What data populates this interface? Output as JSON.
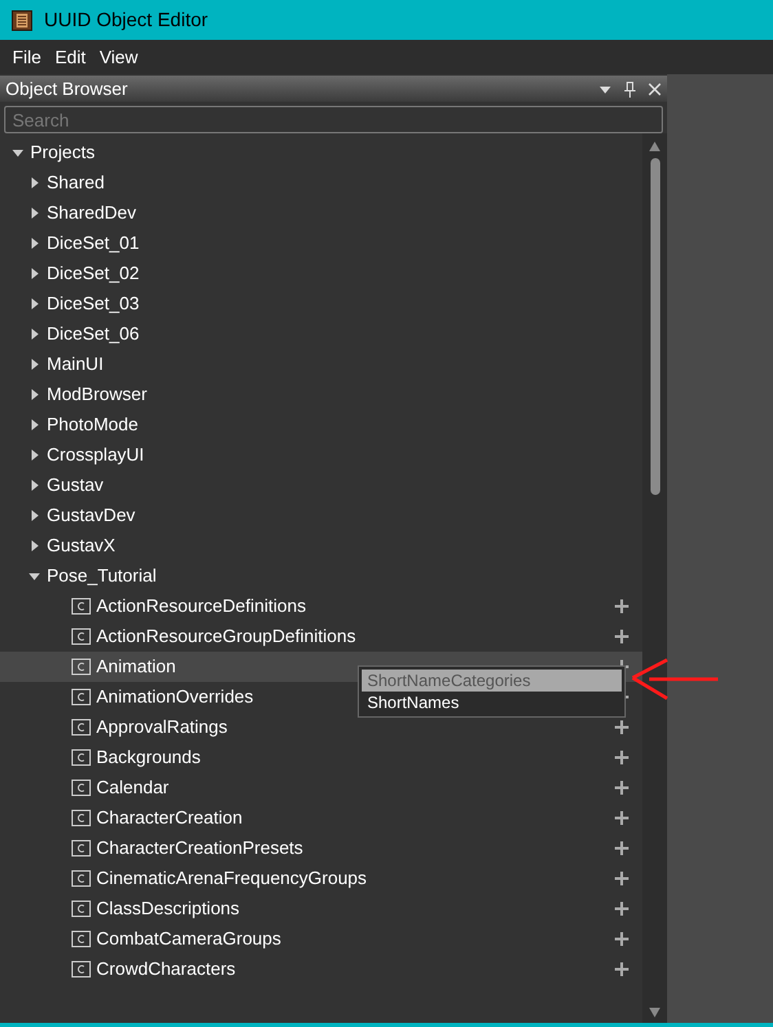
{
  "window": {
    "title": "UUID Object Editor"
  },
  "menu": [
    "File",
    "Edit",
    "View"
  ],
  "panel": {
    "title": "Object Browser",
    "search": {
      "placeholder": "Search"
    }
  },
  "tree": [
    {
      "label": "Projects",
      "expanded": true,
      "selected": false,
      "children": [
        {
          "label": "Shared",
          "expanded": false,
          "selected": false
        },
        {
          "label": "SharedDev",
          "expanded": false,
          "selected": false
        },
        {
          "label": "DiceSet_01",
          "expanded": false,
          "selected": false
        },
        {
          "label": "DiceSet_02",
          "expanded": false,
          "selected": false
        },
        {
          "label": "DiceSet_03",
          "expanded": false,
          "selected": false
        },
        {
          "label": "DiceSet_06",
          "expanded": false,
          "selected": false
        },
        {
          "label": "MainUI",
          "expanded": false,
          "selected": false
        },
        {
          "label": "ModBrowser",
          "expanded": false,
          "selected": false
        },
        {
          "label": "PhotoMode",
          "expanded": false,
          "selected": false
        },
        {
          "label": "CrossplayUI",
          "expanded": false,
          "selected": false
        },
        {
          "label": "Gustav",
          "expanded": false,
          "selected": false
        },
        {
          "label": "GustavDev",
          "expanded": false,
          "selected": false
        },
        {
          "label": "GustavX",
          "expanded": false,
          "selected": false
        },
        {
          "label": "Pose_Tutorial",
          "expanded": true,
          "selected": false,
          "children": [
            {
              "label": "ActionResourceDefinitions",
              "selected": false
            },
            {
              "label": "ActionResourceGroupDefinitions",
              "selected": false
            },
            {
              "label": "Animation",
              "selected": true
            },
            {
              "label": "AnimationOverrides",
              "selected": false
            },
            {
              "label": "ApprovalRatings",
              "selected": false
            },
            {
              "label": "Backgrounds",
              "selected": false
            },
            {
              "label": "Calendar",
              "selected": false
            },
            {
              "label": "CharacterCreation",
              "selected": false
            },
            {
              "label": "CharacterCreationPresets",
              "selected": false
            },
            {
              "label": "CinematicArenaFrequencyGroups",
              "selected": false
            },
            {
              "label": "ClassDescriptions",
              "selected": false
            },
            {
              "label": "CombatCameraGroups",
              "selected": false
            },
            {
              "label": "CrowdCharacters",
              "selected": false
            }
          ]
        }
      ]
    }
  ],
  "context_menu": [
    {
      "label": "ShortNameCategories",
      "selected": true
    },
    {
      "label": "ShortNames",
      "selected": false
    }
  ]
}
